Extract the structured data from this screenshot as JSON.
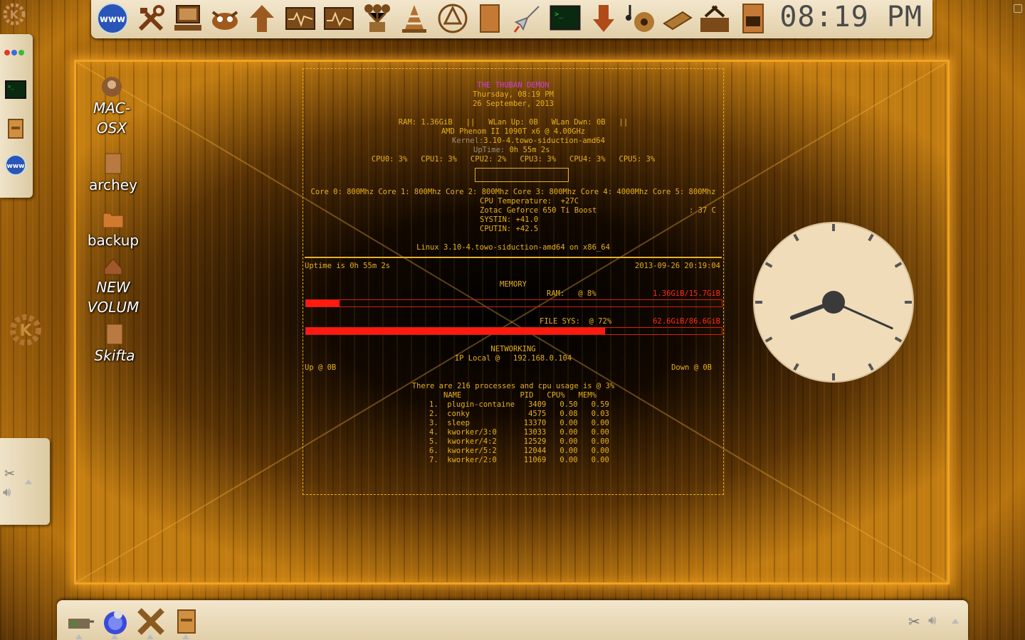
{
  "top_panel": {
    "clock": "08:19 PM",
    "launchers": [
      "www-browser-icon",
      "tools-icon",
      "computer-icon",
      "gimp-icon",
      "network-icon",
      "system-monitor-icon",
      "system-monitor-2-icon",
      "network-share-icon",
      "vlc-icon",
      "inkscape-icon",
      "document-icon",
      "rocket-icon",
      "terminal-icon",
      "download-icon",
      "music-icon",
      "calculator-icon",
      "settings-icon",
      "file-cabinet-icon"
    ]
  },
  "desktop_icons": [
    {
      "label": "MAC-\nOSX",
      "icon": "user-icon"
    },
    {
      "label": "archey",
      "icon": "script-icon"
    },
    {
      "label": "backup",
      "icon": "folder-icon"
    },
    {
      "label": "NEW\nVOLUM",
      "icon": "drive-icon"
    },
    {
      "label": "Skifta",
      "icon": "script-icon"
    }
  ],
  "conky": {
    "title": "THE THUBAN DEMON",
    "day_time": "Thursday, 08:19 PM",
    "date": "26 September, 2013",
    "ram_line": "RAM: 1.36GiB   ||   WLan Up: 0B   WLan Dwn: 0B   ||",
    "cpu_model": "AMD Phenom II 1090T x6 @ 4.00GHz",
    "kernel_label": "Kernel:",
    "kernel_value": "3.10-4.towo-siduction-amd64",
    "uptime_label": "UpTime:",
    "uptime_value": " 0h 55m 2s",
    "cpu_usage": "CPU0: 3%   CPU1: 3%   CPU2: 2%   CPU3: 3%   CPU4: 3%   CPU5: 3%",
    "cores": "Core 0: 800Mhz Core 1: 800Mhz Core 2: 800Mhz Core 3: 800Mhz Core 4: 4000Mhz Core 5: 800Mhz",
    "cpu_temp": "CPU Temperature:  +27C",
    "gpu": "Zotac Geforce 650 Ti Boost",
    "gpu_temp": ": 37 C",
    "systin": "SYSTIN: +41.0",
    "cputin": "CPUTIN: +42.5",
    "os_line": "Linux 3.10-4.towo-siduction-amd64 on x86_64",
    "uptime_line": "Uptime is 0h 55m 2s",
    "timestamp": "2013-09-26 20:19:04",
    "memory_header": "MEMORY",
    "ram_label": "RAM:   @ 8%",
    "ram_used": "1.36GiB/15.7GiB",
    "ram_percent": 8,
    "fs_label": "FILE SYS:  @ 72%",
    "fs_used": "62.6GiB/86.6GiB",
    "fs_percent": 72,
    "networking_header": "NETWORKING",
    "ip_line": "IP Local @   192.168.0.104",
    "up_line": "Up @ 0B",
    "down_line": "Down @ 0B",
    "proc_line": "There are 216 processes and cpu usage is @ 3%",
    "proc_header": "NAME             PID   CPU%   MEM%",
    "processes": [
      "1.  plugin-containe   3409   0.50   0.59",
      "2.  conky             4575   0.08   0.03",
      "3.  sleep            13370   0.00   0.00",
      "4.  kworker/3:0      13033   0.00   0.00",
      "5.  kworker/4:2      12529   0.00   0.00",
      "6.  kworker/5:2      12044   0.00   0.00",
      "7.  kworker/2:0      11069   0.00   0.00"
    ]
  },
  "analog_clock": {
    "hour": 8,
    "minute": 19
  },
  "colors": {
    "accent": "#e7b020",
    "magenta": "#d33fd3",
    "red": "#ff1a10",
    "panel": "#efe3c8"
  }
}
